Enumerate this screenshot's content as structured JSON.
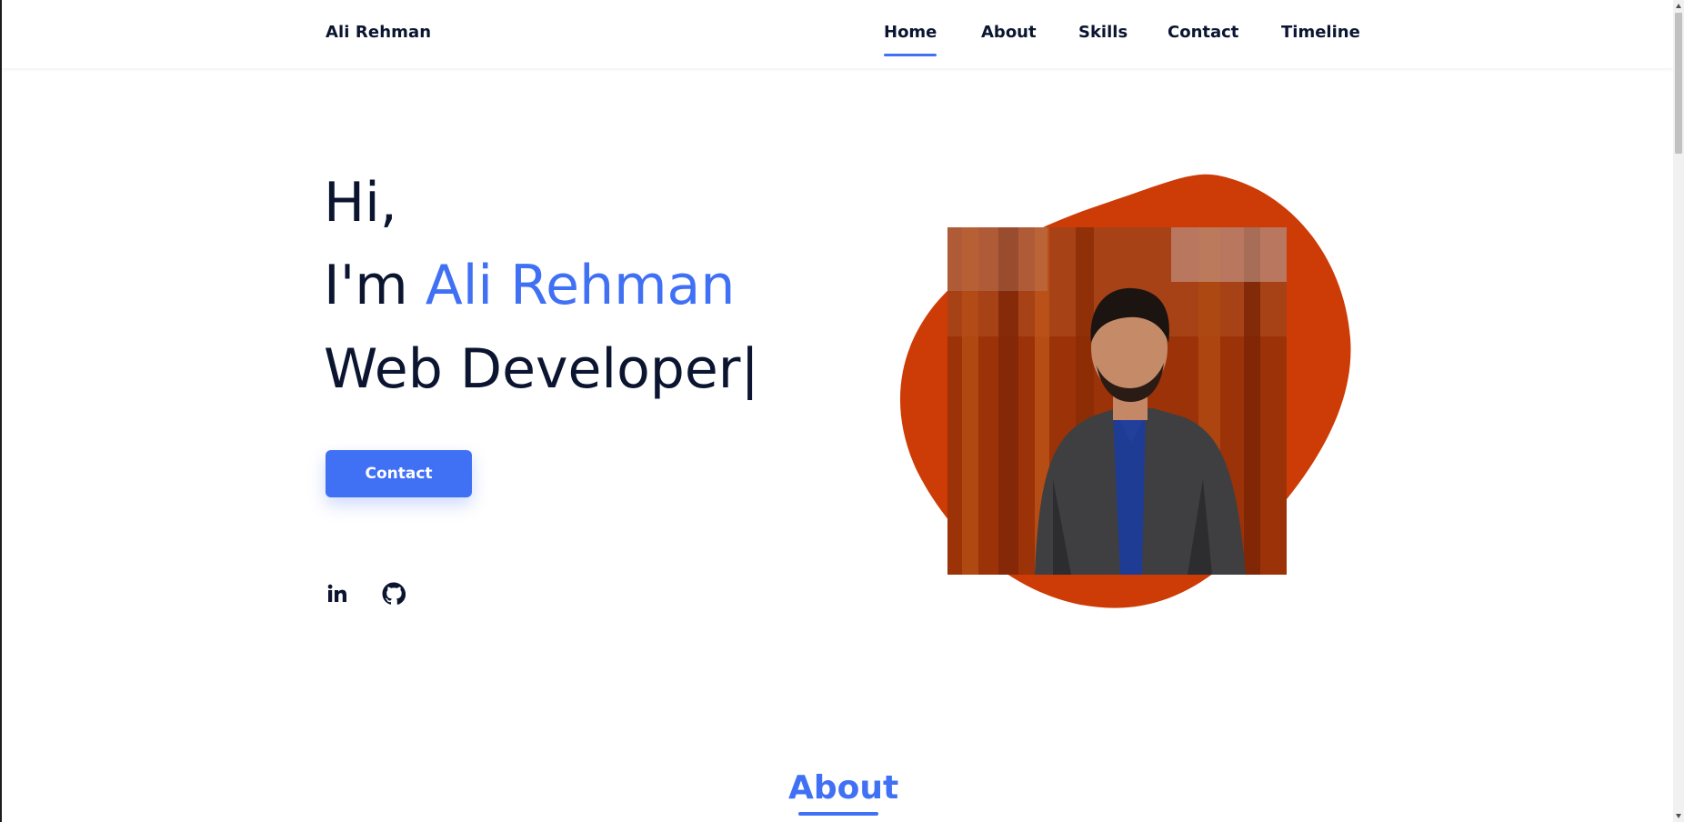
{
  "header": {
    "brand": "Ali Rehman",
    "nav": [
      {
        "label": "Home",
        "active": true
      },
      {
        "label": "About",
        "active": false
      },
      {
        "label": "Skills",
        "active": false
      },
      {
        "label": "Contact",
        "active": false
      },
      {
        "label": "Timeline",
        "active": false
      }
    ]
  },
  "hero": {
    "greeting": "Hi,",
    "intro_prefix": "I'm ",
    "name": "Ali Rehman",
    "role": "Web Developer|",
    "contact_button": "Contact",
    "socials": [
      {
        "icon": "linkedin-icon"
      },
      {
        "icon": "github-icon"
      }
    ],
    "photo": {
      "description_icon": "profile-photo",
      "blob_color": "#cd3b06"
    }
  },
  "about": {
    "title": "About"
  },
  "colors": {
    "accent": "#4070f4",
    "text": "#0b1530",
    "blob": "#cd3b06"
  }
}
